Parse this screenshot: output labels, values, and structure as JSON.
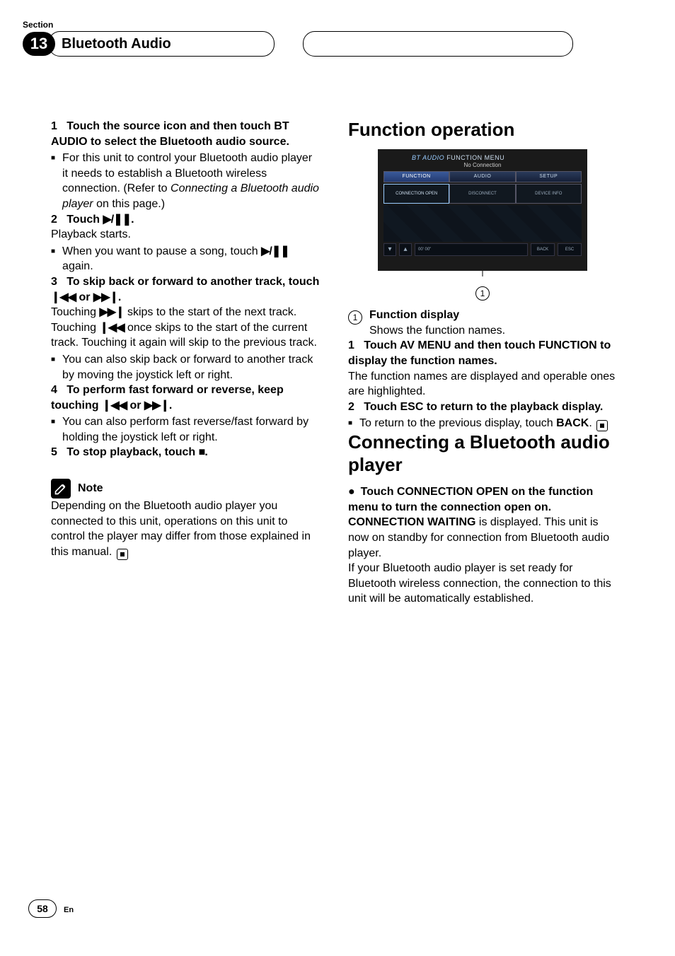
{
  "header": {
    "section_label": "Section",
    "section_number": "13",
    "title": "Bluetooth Audio"
  },
  "left": {
    "step1": {
      "num": "1",
      "head": "Touch the source icon and then touch BT AUDIO to select the Bluetooth audio source.",
      "sub": "For this unit to control your Bluetooth audio player it needs to establish a Bluetooth wireless connection. (Refer to ",
      "sub_link": "Connecting a Bluetooth audio player",
      "sub_after": " on this page.)"
    },
    "step2": {
      "num": "2",
      "head_before": "Touch ",
      "head_glyph": "▶/❚❚",
      "head_after": ".",
      "line1": "Playback starts.",
      "sub_before": "When you want to pause a song, touch ",
      "sub_glyph": "▶/❚❚",
      "sub_after": " again."
    },
    "step3": {
      "num": "3",
      "head_before": "To skip back or forward to another track, touch ",
      "head_g1": "❙◀◀",
      "head_mid": " or ",
      "head_g2": "▶▶❙",
      "head_after": ".",
      "body_before": "Touching ",
      "body_g1": "▶▶❙",
      "body_mid1": " skips to the start of the next track. Touching ",
      "body_g2": "❙◀◀",
      "body_mid2": " once skips to the start of the current track. Touching it again will skip to the previous track.",
      "sub": "You can also skip back or forward to another track by moving the joystick left or right."
    },
    "step4": {
      "num": "4",
      "head_before": "To perform fast forward or reverse, keep touching ",
      "head_g1": "❙◀◀",
      "head_mid": " or ",
      "head_g2": "▶▶❙",
      "head_after": ".",
      "sub": "You can also perform fast reverse/fast forward by holding the joystick left or right."
    },
    "step5": {
      "num": "5",
      "head_before": "To stop playback, touch ",
      "head_glyph": "■",
      "head_after": "."
    },
    "note": {
      "label": "Note",
      "body": "Depending on the Bluetooth audio player you connected to this unit, operations on this unit to control the player may differ from those explained in this manual."
    }
  },
  "right": {
    "h_func": "Function operation",
    "shot": {
      "title": "BT AUDIO",
      "title2": "FUNCTION MENU",
      "sub": "No Connection",
      "tab1": "FUNCTION",
      "tab2": "AUDIO",
      "tab3": "SETUP",
      "b1": "CONNECTION OPEN",
      "b2": "DISCONNECT",
      "b3": "DEVICE INFO",
      "status": "00' 00\"",
      "back": "BACK",
      "esc": "ESC"
    },
    "callout_num": "1",
    "item1": {
      "label": "Function display",
      "desc": "Shows the function names."
    },
    "fstep1": {
      "num": "1",
      "head": "Touch AV MENU and then touch FUNCTION to display the function names.",
      "body": "The function names are displayed and operable ones are highlighted."
    },
    "fstep2": {
      "num": "2",
      "head": "Touch ESC to return to the playback display.",
      "sub_before": "To return to the previous display, touch ",
      "sub_bold": "BACK",
      "sub_after": "."
    },
    "h_conn": "Connecting a Bluetooth audio player",
    "conn": {
      "bullet_head": "Touch CONNECTION OPEN on the function menu to turn the connection open on.",
      "l1_bold": "CONNECTION WAITING",
      "l1_rest": " is displayed. This unit is now on standby for connection from Bluetooth audio player.",
      "l2": "If your Bluetooth audio player is set ready for Bluetooth wireless connection, the connection to this unit will be automatically established."
    }
  },
  "footer": {
    "page": "58",
    "lang": "En"
  }
}
